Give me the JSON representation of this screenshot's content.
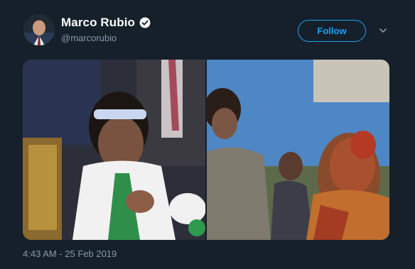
{
  "author": {
    "display_name": "Marco Rubio",
    "handle": "@marcorubio",
    "verified": true
  },
  "actions": {
    "follow_label": "Follow"
  },
  "icons": {
    "verified": "verified-badge-icon",
    "menu": "chevron-down-icon"
  },
  "tweet": {
    "timestamp": "4:43 AM - 25 Feb 2019"
  },
  "colors": {
    "background": "#15202b",
    "accent": "#1da1f2",
    "secondary_text": "#8899a6"
  }
}
